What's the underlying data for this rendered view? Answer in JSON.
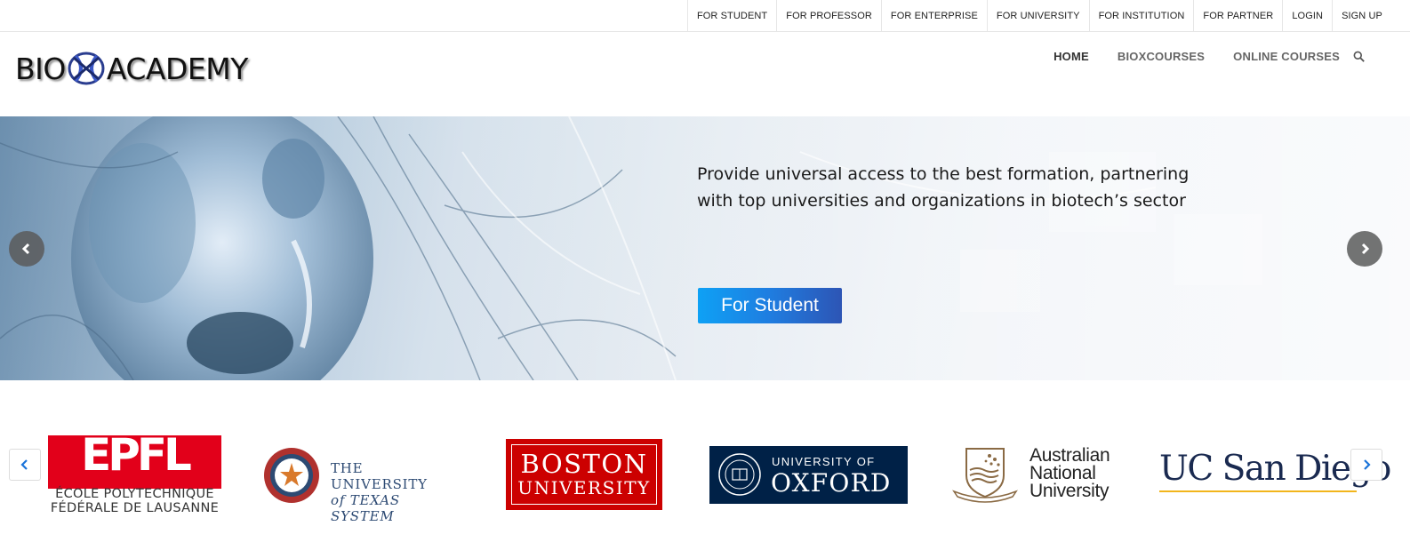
{
  "topbar": {
    "links": [
      "FOR STUDENT",
      "FOR PROFESSOR",
      "FOR ENTERPRISE",
      "FOR UNIVERSITY",
      "FOR INSTITUTION",
      "FOR PARTNER",
      "LOGIN",
      "SIGN UP"
    ]
  },
  "header": {
    "logo_left": "BIO",
    "logo_right": "ACADEMY",
    "nav": [
      "HOME",
      "BIOXCOURSES",
      "ONLINE COURSES"
    ],
    "search_icon": "search-icon"
  },
  "hero": {
    "line1": "Provide universal access to the best formation, partnering",
    "line2": "with top universities and organizations in biotech’s sector",
    "button": "For Student"
  },
  "partners": {
    "epfl": {
      "word": "EPFL",
      "line1": "ÉCOLE POLYTECHNIQUE",
      "line2": "FÉDÉRALE DE LAUSANNE"
    },
    "utexas": {
      "line1": "THE UNIVERSITY",
      "line2": "of TEXAS SYSTEM"
    },
    "boston": {
      "line1": "BOSTON",
      "line2": "UNIVERSITY"
    },
    "oxford": {
      "line1": "UNIVERSITY OF",
      "line2": "OXFORD"
    },
    "anu": {
      "line1": "Australian",
      "line2": "National",
      "line3": "University"
    },
    "ucsd": {
      "name": "UC San Diego"
    }
  },
  "colors": {
    "accent_blue": "#1f7de0",
    "epfl_red": "#e2001a",
    "boston_red": "#cc0000",
    "oxford_navy": "#002147",
    "ucsd_gold": "#f2b51c"
  }
}
